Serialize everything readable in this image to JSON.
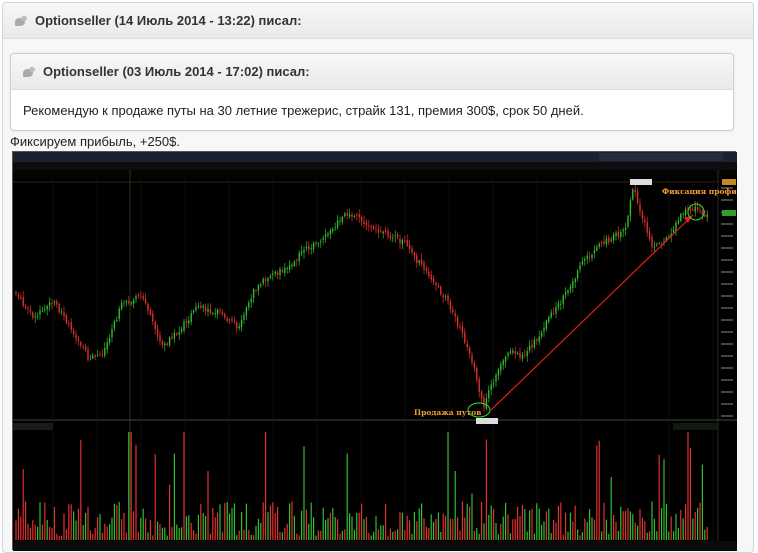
{
  "outer_quote": {
    "header": "Optionseller (14 Июль 2014 - 13:22) писал:"
  },
  "inner_quote": {
    "header": "Optionseller (03 Июль 2014 - 17:02) писал:",
    "body": "Рекомендую к продаже путы на 30 летние трежерис, страйк 131, премия 300$, срок 50 дней."
  },
  "caption": "Фиксируем прибыль, +250$.",
  "chart_annotations": {
    "entry_label": "Продажа путов",
    "exit_label": "Фиксация профита"
  },
  "colors": {
    "up_candle": "#2fbf2f",
    "down_candle": "#e03030",
    "arrow": "#e02020",
    "annotation": "#f0a030",
    "circle": "#33dd33"
  }
}
